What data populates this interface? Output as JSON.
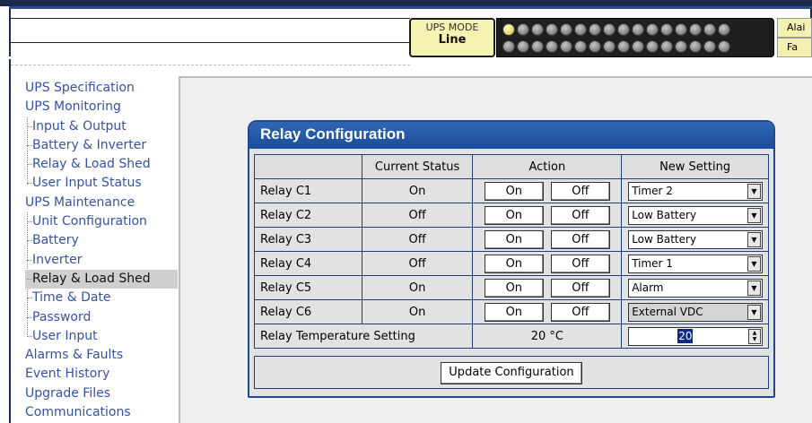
{
  "header": {
    "ups_mode_title": "UPS MODE",
    "ups_mode_value": "Line",
    "alarm_label": "Alai",
    "fault_label": "Fa"
  },
  "sidebar": {
    "items": [
      {
        "label": "UPS Specification",
        "level": 0
      },
      {
        "label": "UPS Monitoring",
        "level": 0
      },
      {
        "label": "Input & Output",
        "level": 1
      },
      {
        "label": "Battery & Inverter",
        "level": 1
      },
      {
        "label": "Relay & Load Shed",
        "level": 1
      },
      {
        "label": "User Input Status",
        "level": 1
      },
      {
        "label": "UPS Maintenance",
        "level": 0
      },
      {
        "label": "Unit Configuration",
        "level": 1
      },
      {
        "label": "Battery",
        "level": 1
      },
      {
        "label": "Inverter",
        "level": 1
      },
      {
        "label": "Relay & Load Shed",
        "level": 1,
        "active": true
      },
      {
        "label": "Time & Date",
        "level": 1
      },
      {
        "label": "Password",
        "level": 1
      },
      {
        "label": "User Input",
        "level": 1
      },
      {
        "label": "Alarms & Faults",
        "level": 0
      },
      {
        "label": "Event History",
        "level": 0
      },
      {
        "label": "Upgrade Files",
        "level": 0
      },
      {
        "label": "Communications",
        "level": 0
      }
    ]
  },
  "relay_config": {
    "title": "Relay Configuration",
    "columns": [
      "",
      "Current Status",
      "Action",
      "New Setting"
    ],
    "on_label": "On",
    "off_label": "Off",
    "rows": [
      {
        "name": "Relay C1",
        "status": "On",
        "setting": "Timer 2"
      },
      {
        "name": "Relay C2",
        "status": "Off",
        "setting": "Low Battery"
      },
      {
        "name": "Relay C3",
        "status": "Off",
        "setting": "Low Battery"
      },
      {
        "name": "Relay C4",
        "status": "Off",
        "setting": "Timer 1"
      },
      {
        "name": "Relay C5",
        "status": "On",
        "setting": "Alarm"
      },
      {
        "name": "Relay C6",
        "status": "On",
        "setting": "External VDC"
      }
    ],
    "temperature": {
      "label": "Relay Temperature Setting",
      "current": "20 °C",
      "new_value": "20"
    },
    "update_button": "Update Configuration"
  }
}
